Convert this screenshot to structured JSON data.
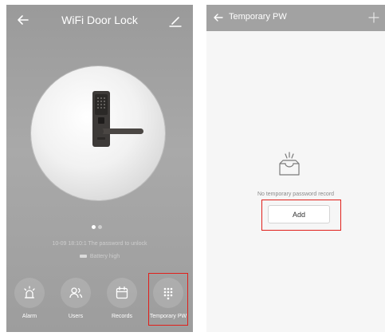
{
  "left_screen": {
    "title": "WiFi Door Lock",
    "status_text": "10-09 18:10:1 The password to unlock",
    "battery_text": "Battery high",
    "nav": [
      {
        "label": "Alarm",
        "icon": "alarm-icon"
      },
      {
        "label": "Users",
        "icon": "users-icon"
      },
      {
        "label": "Records",
        "icon": "calendar-icon"
      },
      {
        "label": "Temporary PW",
        "icon": "keypad-icon"
      }
    ],
    "highlighted_item": "Temporary PW"
  },
  "right_screen": {
    "title": "Temporary PW",
    "empty_text": "No temporary password record",
    "add_label": "Add"
  },
  "colors": {
    "highlight": "#e0201b",
    "header_gray": "#a2a2a2",
    "background_light": "#f6f6f6"
  }
}
